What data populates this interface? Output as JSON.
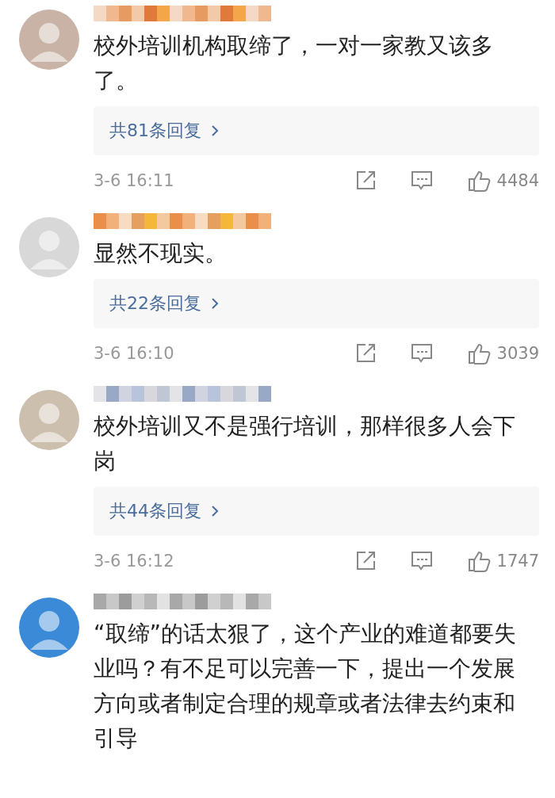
{
  "comments": [
    {
      "text": "校外培训机构取缔了，一对一家教又该多了。",
      "replies": "共81条回复",
      "time": "3-6 16:11",
      "likes": "4484"
    },
    {
      "text": "显然不现实。",
      "replies": "共22条回复",
      "time": "3-6 16:10",
      "likes": "3039"
    },
    {
      "text": "校外培训又不是强行培训，那样很多人会下岗",
      "replies": "共44条回复",
      "time": "3-6 16:12",
      "likes": "1747"
    },
    {
      "text": "“取缔”的话太狠了，这个产业的难道都要失业吗？有不足可以完善一下，提出一个发展方向或者制定合理的规章或者法律去约束和引导"
    }
  ]
}
